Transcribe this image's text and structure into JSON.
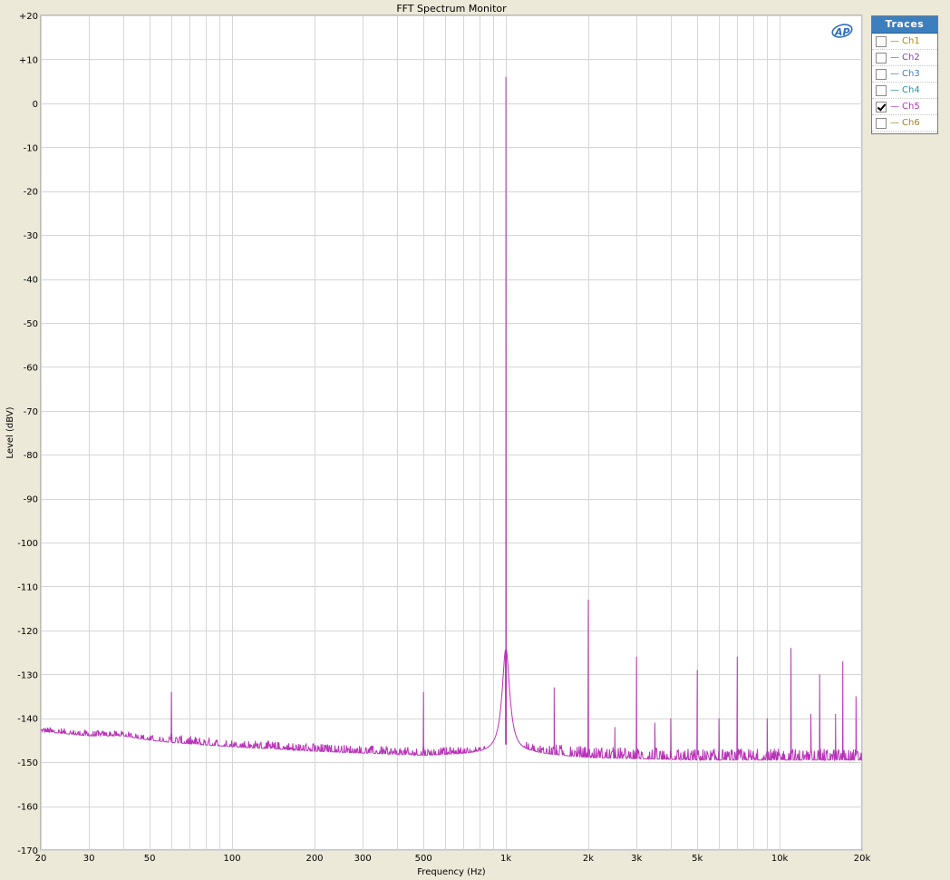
{
  "chart_data": {
    "type": "line",
    "title": "FFT Spectrum Monitor",
    "xlabel": "Frequency (Hz)",
    "ylabel": "Level (dBV)",
    "xscale": "log",
    "xlim": [
      20,
      20000
    ],
    "ylim": [
      -170,
      20
    ],
    "grid": true,
    "xticks": [
      20,
      30,
      50,
      100,
      200,
      300,
      500,
      1000,
      2000,
      3000,
      5000,
      10000,
      20000
    ],
    "xticklabels": [
      "20",
      "30",
      "50",
      "100",
      "200",
      "300",
      "500",
      "1k",
      "2k",
      "3k",
      "5k",
      "10k",
      "20k"
    ],
    "yticks": [
      20,
      10,
      0,
      -10,
      -20,
      -30,
      -40,
      -50,
      -60,
      -70,
      -80,
      -90,
      -100,
      -110,
      -120,
      -130,
      -140,
      -150,
      -160,
      -170
    ],
    "yticklabels": [
      "+20",
      "+10",
      "0",
      "-10",
      "-20",
      "-30",
      "-40",
      "-50",
      "-60",
      "-70",
      "-80",
      "-90",
      "-100",
      "-110",
      "-120",
      "-130",
      "-140",
      "-150",
      "-160",
      "-170"
    ],
    "series": [
      {
        "name": "Ch5",
        "color": "#B833B8",
        "baseline": [
          [
            20,
            -143
          ],
          [
            30,
            -144
          ],
          [
            40,
            -144
          ],
          [
            50,
            -145
          ],
          [
            60,
            -145.5
          ],
          [
            100,
            -146.5
          ],
          [
            200,
            -147.5
          ],
          [
            500,
            -148.5
          ],
          [
            900,
            -148
          ],
          [
            1200,
            -148
          ],
          [
            2000,
            -149
          ],
          [
            5000,
            -149.5
          ],
          [
            10000,
            -149.5
          ],
          [
            20000,
            -149.5
          ]
        ],
        "peaks": [
          {
            "x": 60,
            "y": -134
          },
          {
            "x": 500,
            "y": -134
          },
          {
            "x": 1000,
            "y": 6
          },
          {
            "x": 1500,
            "y": -133
          },
          {
            "x": 2000,
            "y": -113
          },
          {
            "x": 2500,
            "y": -142
          },
          {
            "x": 3000,
            "y": -126
          },
          {
            "x": 3500,
            "y": -141
          },
          {
            "x": 4000,
            "y": -140
          },
          {
            "x": 5000,
            "y": -129
          },
          {
            "x": 6000,
            "y": -140
          },
          {
            "x": 7000,
            "y": -126
          },
          {
            "x": 9000,
            "y": -140
          },
          {
            "x": 11000,
            "y": -124
          },
          {
            "x": 13000,
            "y": -139
          },
          {
            "x": 14000,
            "y": -130
          },
          {
            "x": 16000,
            "y": -139
          },
          {
            "x": 17000,
            "y": -127
          },
          {
            "x": 19000,
            "y": -135
          }
        ]
      }
    ]
  },
  "traces_panel": {
    "title": "Traces",
    "items": [
      {
        "label": "Ch1",
        "checked": false,
        "color": "#B08C00"
      },
      {
        "label": "Ch2",
        "checked": false,
        "color": "#8E3FB8"
      },
      {
        "label": "Ch3",
        "checked": false,
        "color": "#3F7FBF"
      },
      {
        "label": "Ch4",
        "checked": false,
        "color": "#2E8FA0"
      },
      {
        "label": "Ch5",
        "checked": true,
        "color": "#B833B8"
      },
      {
        "label": "Ch6",
        "checked": false,
        "color": "#A87C2A"
      }
    ]
  },
  "logo_text": "AP"
}
